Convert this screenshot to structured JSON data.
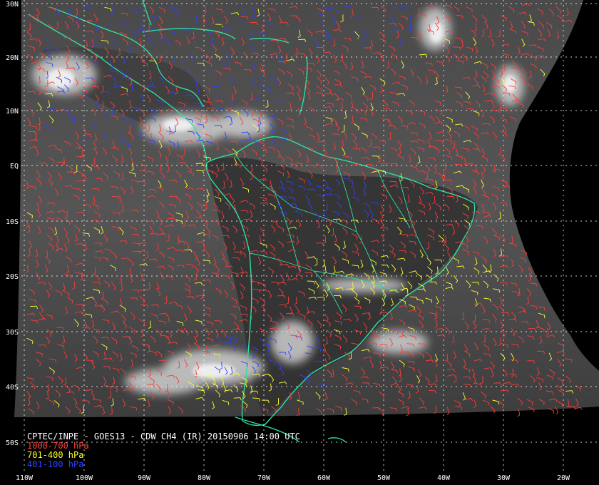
{
  "map": {
    "title": "CPTEC/INPE - GOES13 - CDW CH4 (IR) 20150906 14:00 UTC",
    "legend": [
      {
        "label": "1000-700 hPa",
        "color": "#ff3b3b"
      },
      {
        "label": "701-400 hPa",
        "color": "#ffff2a"
      },
      {
        "label": "401-100 hPa",
        "color": "#3040ff"
      }
    ],
    "latitude_labels": [
      "30N",
      "20N",
      "10N",
      "EQ",
      "10S",
      "20S",
      "30S",
      "40S",
      "50S"
    ],
    "longitude_labels": [
      "110W",
      "100W",
      "90W",
      "80W",
      "70W",
      "60W",
      "50W",
      "40W",
      "30W",
      "20W"
    ],
    "colors": {
      "background": "#000000",
      "coastline": "#2fe0a0",
      "grid": "#ffffff",
      "low_level_wind": "#ff3b3b",
      "mid_level_wind": "#ffff2a",
      "high_level_wind": "#3040ff"
    }
  }
}
